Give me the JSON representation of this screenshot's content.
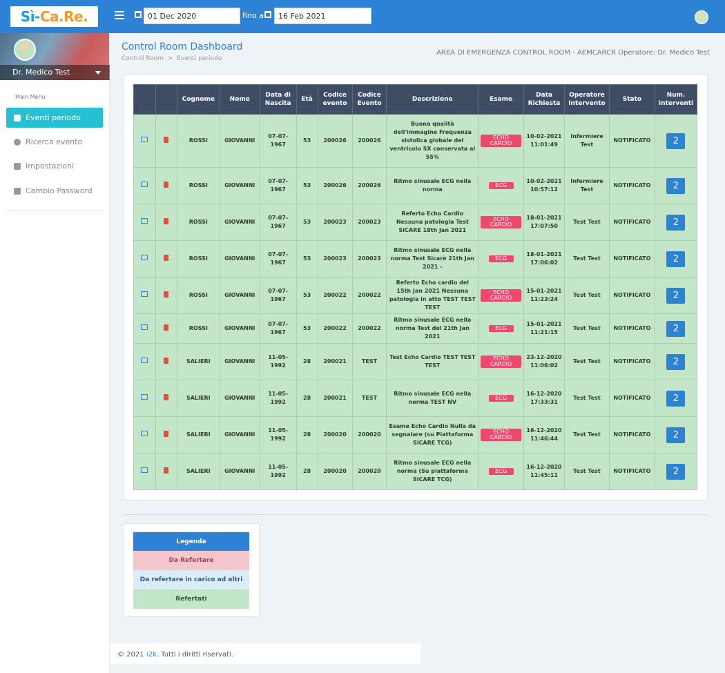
{
  "brand": {
    "logo_part1": "Sì-",
    "logo_part2": "Ca.Re."
  },
  "topbar": {
    "date_from": "01 Dec 2020",
    "to_label": "fino a",
    "date_to": "16 Feb 2021"
  },
  "sidebar": {
    "user_name": "Dr. Medico Test",
    "menu_title": "Main Menu",
    "items": [
      {
        "label": "Eventi periodo",
        "icon": "calendar-icon",
        "active": true
      },
      {
        "label": "Ricerca evento",
        "icon": "search-icon",
        "active": false
      },
      {
        "label": "Impostazioni",
        "icon": "gear-icon",
        "active": false
      },
      {
        "label": "Cambio Password",
        "icon": "document-icon",
        "active": false
      }
    ]
  },
  "header": {
    "title": "Control Room Dashboard",
    "breadcrumb_root": "Control Room",
    "breadcrumb_sep": ">",
    "breadcrumb_current": "Eventi periodo",
    "area_info": "AREA DI EMERGENZA CONTROL ROOM - AEMCARCR Operatore: Dr. Medico Test"
  },
  "table": {
    "headers": [
      "",
      "",
      "Cognome",
      "Nome",
      "Data di Nascita",
      "Età",
      "Codice evento",
      "Codice Evento",
      "Descrizione",
      "Esame",
      "Data Richiesta",
      "Operatore Intervento",
      "Stato",
      "Num. Interventi"
    ],
    "rows": [
      {
        "cognome": "ROSSI",
        "nome": "GIOVANNI",
        "nascita": "07-07-1967",
        "eta": "53",
        "cod1": "200026",
        "cod2": "200026",
        "descrizione": "Buona qualità dell'immagine Frequenza sistolica globale del ventricolo SX conservata al 55%",
        "esame": "ECHO CARDIO",
        "data": "10-02-2021 11:01:49",
        "operatore": "Infermiere Test",
        "stato": "NOTIFICATO",
        "num": "2"
      },
      {
        "cognome": "ROSSI",
        "nome": "GIOVANNI",
        "nascita": "07-07-1967",
        "eta": "53",
        "cod1": "200026",
        "cod2": "200026",
        "descrizione": "Ritmo sinusale ECG nella norma",
        "esame": "ECG",
        "data": "10-02-2021 10:57:12",
        "operatore": "Infermiere Test",
        "stato": "NOTIFICATO",
        "num": "2"
      },
      {
        "cognome": "ROSSI",
        "nome": "GIOVANNI",
        "nascita": "07-07-1967",
        "eta": "53",
        "cod1": "200023",
        "cod2": "200023",
        "descrizione": "Referto Echo Cardio Nessuna patologia Test SiCARE 18th Jan 2021",
        "esame": "ECHO CARDIO",
        "data": "18-01-2021 17:07:50",
        "operatore": "Test Test",
        "stato": "NOTIFICATO",
        "num": "2"
      },
      {
        "cognome": "ROSSI",
        "nome": "GIOVANNI",
        "nascita": "07-07-1967",
        "eta": "53",
        "cod1": "200023",
        "cod2": "200023",
        "descrizione": "Ritmo sinusale ECG nella norma Test Sicare 21th Jan 2021 -",
        "esame": "ECG",
        "data": "18-01-2021 17:06:02",
        "operatore": "Test Test",
        "stato": "NOTIFICATO",
        "num": "2"
      },
      {
        "cognome": "ROSSI",
        "nome": "GIOVANNI",
        "nascita": "07-07-1967",
        "eta": "53",
        "cod1": "200022",
        "cod2": "200022",
        "descrizione": "Referto Echo cardio del 15th Jan 2021 Nessuna patologia in atto TEST TEST TEST",
        "esame": "ECHO CARDIO",
        "data": "15-01-2021 11:23:24",
        "operatore": "Test Test",
        "stato": "NOTIFICATO",
        "num": "2"
      },
      {
        "cognome": "ROSSI",
        "nome": "GIOVANNI",
        "nascita": "07-07-1967",
        "eta": "53",
        "cod1": "200022",
        "cod2": "200022",
        "descrizione": "Ritmo sinusale ECG nella norma Test del 21th Jan 2021",
        "esame": "ECG",
        "data": "15-01-2021 11:21:15",
        "operatore": "Test Test",
        "stato": "NOTIFICATO",
        "num": "2"
      },
      {
        "cognome": "SALIERI",
        "nome": "GIOVANNI",
        "nascita": "11-05-1992",
        "eta": "28",
        "cod1": "200021",
        "cod2": "TEST",
        "descrizione": "Test Echo Cardio TEST TEST TEST",
        "esame": "ECHO CARDIO",
        "data": "23-12-2020 11:06:02",
        "operatore": "Test Test",
        "stato": "NOTIFICATO",
        "num": "2"
      },
      {
        "cognome": "SALIERI",
        "nome": "GIOVANNI",
        "nascita": "11-05-1992",
        "eta": "28",
        "cod1": "200021",
        "cod2": "TEST",
        "descrizione": "Ritmo sinusale ECG nella norma TEST NV",
        "esame": "ECG",
        "data": "16-12-2020 17:33:31",
        "operatore": "Test Test",
        "stato": "NOTIFICATO",
        "num": "2"
      },
      {
        "cognome": "SALIERI",
        "nome": "GIOVANNI",
        "nascita": "11-05-1992",
        "eta": "28",
        "cod1": "200020",
        "cod2": "200020",
        "descrizione": "Esame Echo Cardio Nulla da segnalare (su Piattaforma SiCARE TCG)",
        "esame": "ECHO CARDIO",
        "data": "16-12-2020 11:46:44",
        "operatore": "Test Test",
        "stato": "NOTIFICATO",
        "num": "2"
      },
      {
        "cognome": "SALIERI",
        "nome": "GIOVANNI",
        "nascita": "11-05-1992",
        "eta": "28",
        "cod1": "200020",
        "cod2": "200020",
        "descrizione": "Ritmo sinusale ECG nella norma (Su piattaforma SiCARE TCG)",
        "esame": "ECG",
        "data": "16-12-2020 11:45:11",
        "operatore": "Test Test",
        "stato": "NOTIFICATO",
        "num": "2"
      }
    ]
  },
  "legend": {
    "title": "Legenda",
    "items": [
      {
        "label": "Da Refertare",
        "bg": "#f5c6cb",
        "color": "#b03a48"
      },
      {
        "label": "Da refertare in carico ad altri",
        "bg": "#d9ecf7",
        "color": "#2a5d7d"
      },
      {
        "label": "Referati",
        "bg": "#c3e6c9",
        "color": "#2f5a35"
      }
    ],
    "items_label_fix": "Refertati"
  },
  "footer": {
    "prefix": "© 2021 ",
    "link": "i2k",
    "suffix": ". Tutti i diritti riservati."
  },
  "colors": {
    "primary": "#2c83d6",
    "active_menu": "#25c0d4",
    "row_green": "#c3e6c9",
    "header_dark": "#3e4d63",
    "badge": "#ef4870"
  }
}
